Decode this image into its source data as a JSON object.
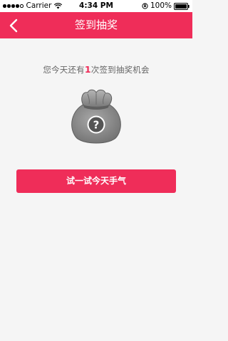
{
  "status_bar": {
    "carrier": "Carrier",
    "time": "4:34 PM",
    "battery": "100%"
  },
  "nav": {
    "title": "签到抽奖",
    "back_icon": "chevron-left-icon"
  },
  "main": {
    "chance_prefix": "您今天还有",
    "chance_count": "1",
    "chance_suffix": "次签到抽奖机会",
    "bag_icon": "mystery-bag-question-icon",
    "try_button_label": "试一试今天手气"
  },
  "colors": {
    "accent": "#ef2d59",
    "background": "#f5f5f5",
    "text_secondary": "#666666"
  }
}
